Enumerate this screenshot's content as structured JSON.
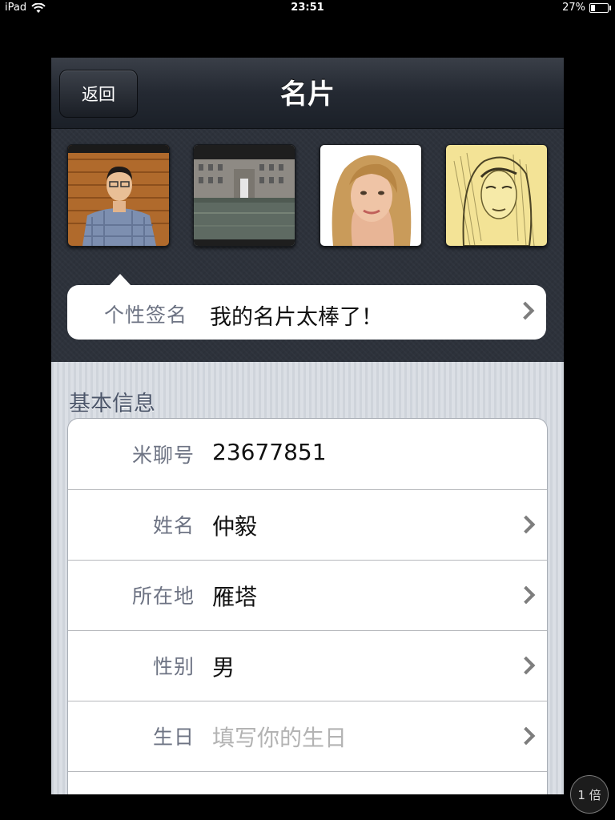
{
  "status_bar": {
    "device": "iPad",
    "time": "23:51",
    "battery": "27%",
    "battery_level": 0.27
  },
  "nav": {
    "back_label": "返回",
    "title": "名片"
  },
  "photos": [
    {
      "name": "photo-man-in-plaid-shirt"
    },
    {
      "name": "photo-building-with-pond"
    },
    {
      "name": "photo-blonde-woman"
    },
    {
      "name": "photo-sketch-woman"
    }
  ],
  "signature": {
    "label": "个性签名",
    "value": "我的名片太棒了！"
  },
  "basic_info": {
    "section_title": "基本信息",
    "rows": [
      {
        "label": "米聊号",
        "value": "23677851",
        "placeholder": false,
        "chevron": false
      },
      {
        "label": "姓名",
        "value": "仲毅",
        "placeholder": false,
        "chevron": true
      },
      {
        "label": "所在地",
        "value": "雁塔",
        "placeholder": false,
        "chevron": true
      },
      {
        "label": "性别",
        "value": "男",
        "placeholder": false,
        "chevron": true
      },
      {
        "label": "生日",
        "value": "填写你的生日",
        "placeholder": true,
        "chevron": true
      }
    ]
  },
  "zoom": {
    "label": "1 倍"
  },
  "colors": {
    "nav_bg": "#242932",
    "header_bg": "#2d323b",
    "label": "#6d7383",
    "placeholder": "#b3b3b3"
  },
  "icons": [
    "wifi-icon",
    "battery-icon",
    "chevron-right-icon"
  ]
}
